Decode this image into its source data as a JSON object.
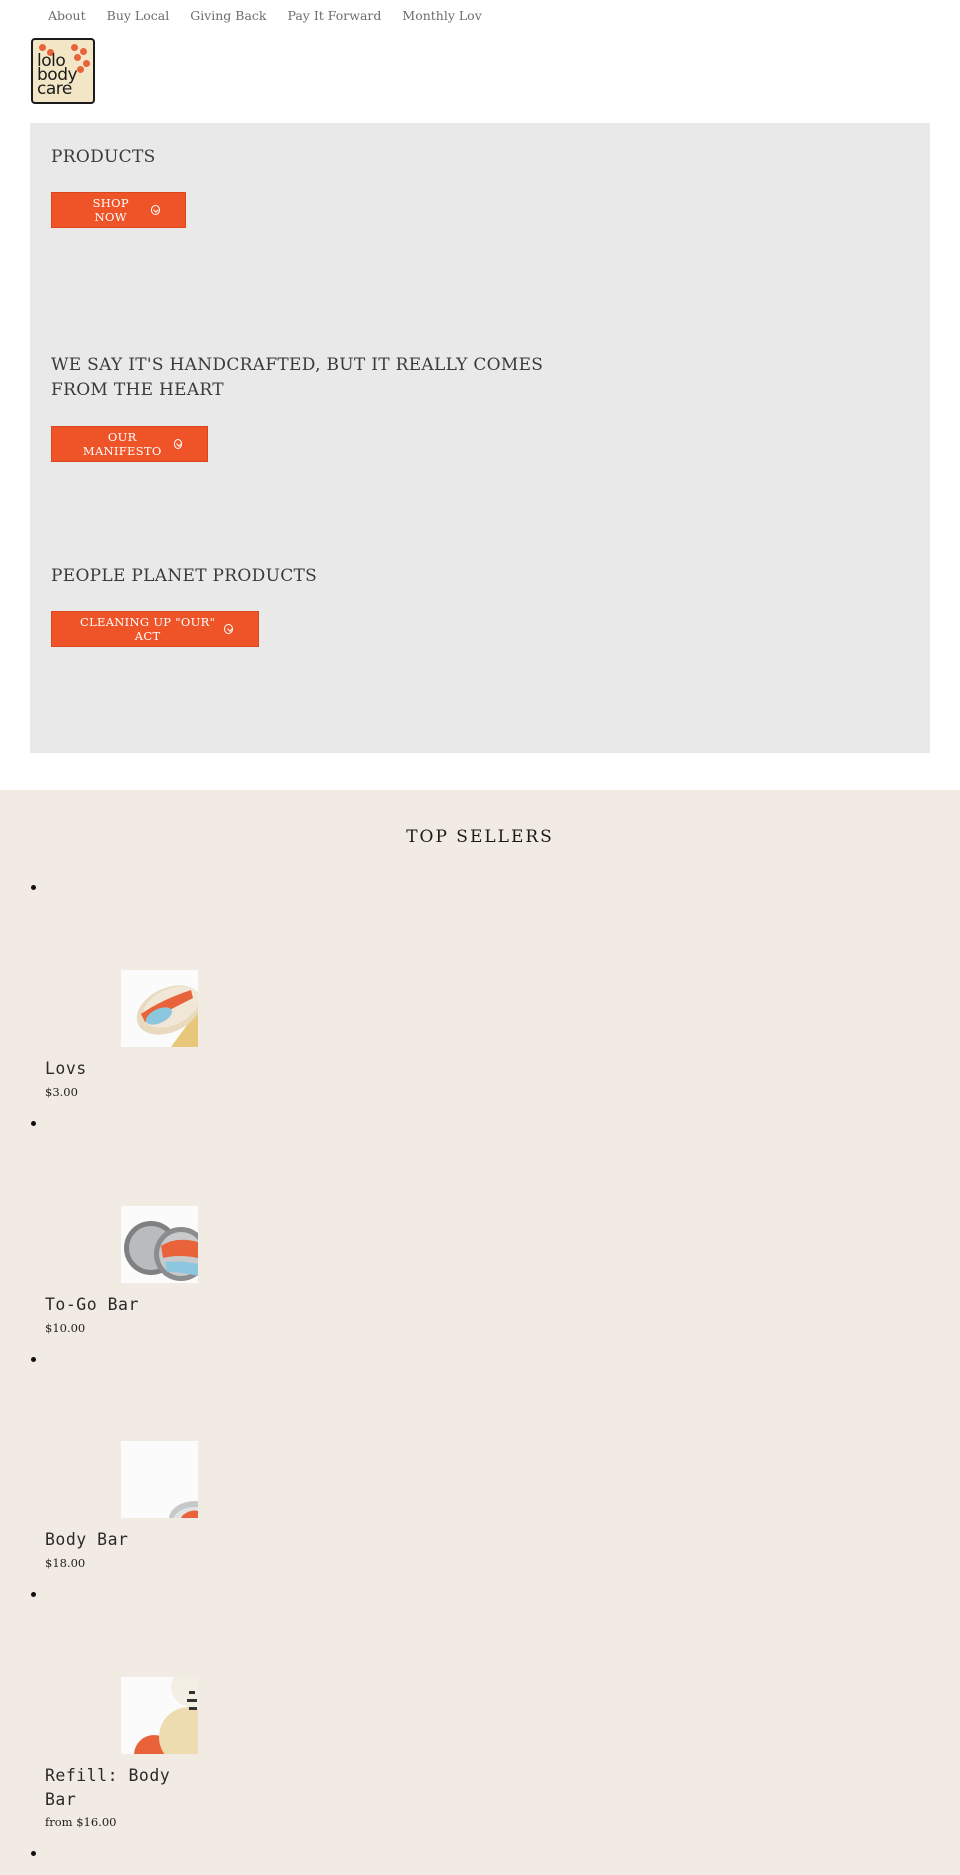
{
  "nav": {
    "items": [
      "About",
      "Buy Local",
      "Giving Back",
      "Pay It Forward",
      "Monthly Lov"
    ]
  },
  "logo": {
    "text": "lolo body care"
  },
  "hero": {
    "slides": [
      {
        "title": "PRODUCTS",
        "button": "SHOP NOW"
      },
      {
        "title": "WE SAY IT'S HANDCRAFTED, BUT IT REALLY COMES FROM THE HEART",
        "button": "OUR MANIFESTO"
      },
      {
        "title": "PEOPLE PLANET PRODUCTS",
        "button": "CLEANING UP \"OUR\" ACT"
      }
    ]
  },
  "top_sellers": {
    "heading": "TOP SELLERS",
    "products": [
      {
        "name": "Lovs",
        "price": "$3.00"
      },
      {
        "name": "To-Go Bar",
        "price": "$10.00"
      },
      {
        "name": "Body Bar",
        "price": "$18.00"
      },
      {
        "name": "Refill: Body Bar",
        "price": "from $16.00"
      }
    ]
  },
  "colors": {
    "accent": "#ef5429",
    "hero_bg": "#e9e9e9",
    "sellers_bg": "#f2ebe3"
  }
}
